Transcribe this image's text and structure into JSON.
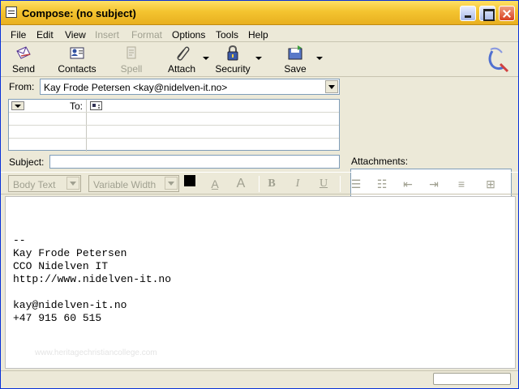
{
  "window": {
    "title": "Compose: (no subject)"
  },
  "menu": [
    {
      "label": "File",
      "enabled": true
    },
    {
      "label": "Edit",
      "enabled": true
    },
    {
      "label": "View",
      "enabled": true
    },
    {
      "label": "Insert",
      "enabled": false
    },
    {
      "label": "Format",
      "enabled": false
    },
    {
      "label": "Options",
      "enabled": true
    },
    {
      "label": "Tools",
      "enabled": true
    },
    {
      "label": "Help",
      "enabled": true
    }
  ],
  "toolbar": {
    "send": "Send",
    "contacts": "Contacts",
    "spell": "Spell",
    "attach": "Attach",
    "security": "Security",
    "save": "Save"
  },
  "header": {
    "from_label": "From:",
    "from_value": "Kay Frode Petersen <kay@nidelven-it.no>",
    "to_label": "To:",
    "subject_label": "Subject:",
    "subject_value": "",
    "attachments_label": "Attachments:"
  },
  "format": {
    "paragraph_style": "Body Text",
    "font": "Variable Width",
    "text_color": "#000000",
    "bg_color": "#FFFFFF"
  },
  "body": {
    "lines": [
      "--",
      "Kay Frode Petersen",
      "CCO Nidelven IT",
      "http://www.nidelven-it.no",
      "",
      "kay@nidelven-it.no",
      "+47 915 60 515"
    ],
    "watermark": "www.heritagechristiancollege.com"
  },
  "colors": {
    "titlebar": "#F4C430",
    "chrome": "#ECE9D8",
    "field_border": "#7F9DB9"
  }
}
